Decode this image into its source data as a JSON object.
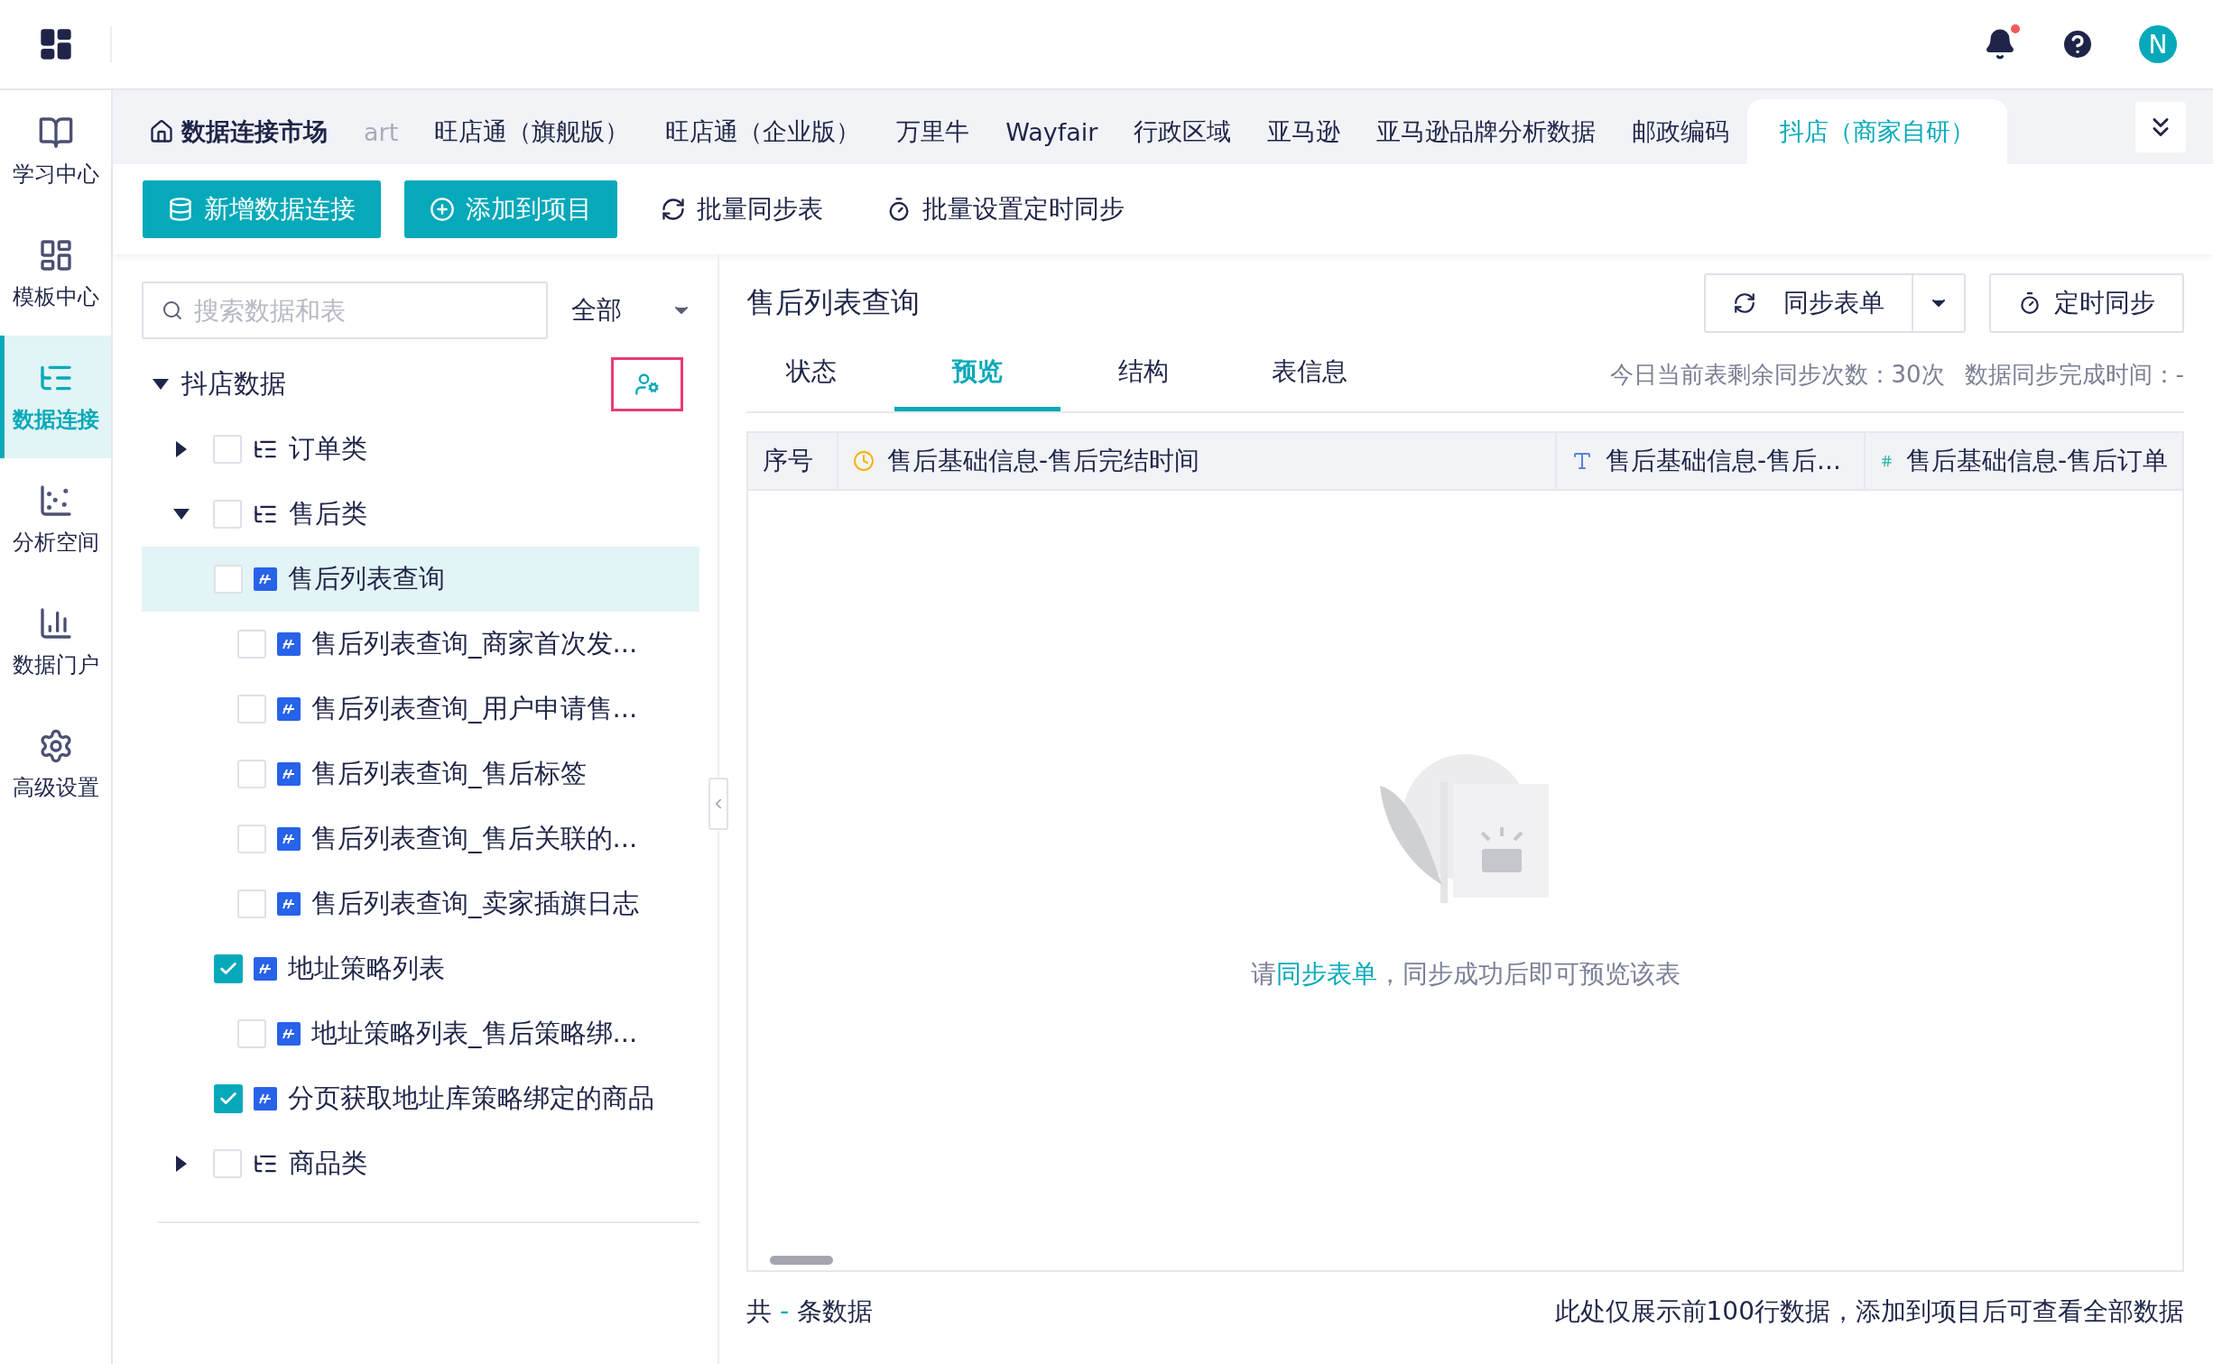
{
  "header": {
    "avatar": "N",
    "has_notification": true
  },
  "sidebar": {
    "items": [
      {
        "label": "学习中心",
        "selected": false
      },
      {
        "label": "模板中心",
        "selected": false
      },
      {
        "label": "数据连接",
        "selected": true
      },
      {
        "label": "分析空间",
        "selected": false
      },
      {
        "label": "数据门户",
        "selected": false
      },
      {
        "label": "高级设置",
        "selected": false
      }
    ]
  },
  "tabs": [
    {
      "label": "数据连接市场",
      "kind": "home",
      "selected": false,
      "clipped": false
    },
    {
      "label": "art",
      "kind": "plain",
      "selected": false,
      "clipped": true
    },
    {
      "label": "旺店通（旗舰版）",
      "kind": "plain",
      "selected": false,
      "clipped": false
    },
    {
      "label": "旺店通（企业版）",
      "kind": "plain",
      "selected": false,
      "clipped": false
    },
    {
      "label": "万里牛",
      "kind": "plain",
      "selected": false,
      "clipped": false
    },
    {
      "label": "Wayfair",
      "kind": "plain",
      "selected": false,
      "clipped": false
    },
    {
      "label": "行政区域",
      "kind": "plain",
      "selected": false,
      "clipped": false
    },
    {
      "label": "亚马逊",
      "kind": "plain",
      "selected": false,
      "clipped": false
    },
    {
      "label": "亚马逊品牌分析数据",
      "kind": "plain",
      "selected": false,
      "clipped": false
    },
    {
      "label": "邮政编码",
      "kind": "plain",
      "selected": false,
      "clipped": false
    },
    {
      "label": "抖店（商家自研）",
      "kind": "plain",
      "selected": true,
      "clipped": false
    }
  ],
  "toolbar": [
    {
      "label": "新增数据连接",
      "kind": "primary"
    },
    {
      "label": "添加到项目",
      "kind": "primary"
    },
    {
      "label": "批量同步表",
      "kind": "text"
    },
    {
      "label": "批量设置定时同步",
      "kind": "text"
    }
  ],
  "search": {
    "placeholder": "搜索数据和表",
    "filter": "全部"
  },
  "tree": {
    "label": "抖店数据",
    "expanded": true,
    "children": [
      {
        "label": "订单类",
        "kind": "folder",
        "checked": false,
        "expanded": false,
        "selected": false
      },
      {
        "label": "售后类",
        "kind": "folder",
        "checked": false,
        "expanded": true,
        "selected": false,
        "children": [
          {
            "label": "售后列表查询",
            "kind": "table",
            "checked": false,
            "selected": true,
            "children": [
              {
                "label": "售后列表查询_商家首次发...",
                "kind": "table",
                "checked": false,
                "selected": false
              },
              {
                "label": "售后列表查询_用户申请售...",
                "kind": "table",
                "checked": false,
                "selected": false
              },
              {
                "label": "售后列表查询_售后标签",
                "kind": "table",
                "checked": false,
                "selected": false
              },
              {
                "label": "售后列表查询_售后关联的...",
                "kind": "table",
                "checked": false,
                "selected": false
              },
              {
                "label": "售后列表查询_卖家插旗日志",
                "kind": "table",
                "checked": false,
                "selected": false
              }
            ]
          },
          {
            "label": "地址策略列表",
            "kind": "table",
            "checked": true,
            "selected": false,
            "children": [
              {
                "label": "地址策略列表_售后策略绑...",
                "kind": "table",
                "checked": false,
                "selected": false
              }
            ]
          },
          {
            "label": "分页获取地址库策略绑定的商品",
            "kind": "table",
            "checked": true,
            "selected": false
          }
        ]
      },
      {
        "label": "商品类",
        "kind": "folder",
        "checked": false,
        "expanded": false,
        "selected": false
      }
    ]
  },
  "detail": {
    "title": "售后列表查询",
    "sync_button": "同步表单",
    "schedule_button": "定时同步",
    "tabs": [
      {
        "label": "状态",
        "selected": false
      },
      {
        "label": "预览",
        "selected": true
      },
      {
        "label": "结构",
        "selected": false
      },
      {
        "label": "表信息",
        "selected": false
      }
    ],
    "sync_count": "今日当前表剩余同步次数：30次",
    "sync_time": "数据同步完成时间：-",
    "columns": [
      {
        "label": "序号",
        "kind": "index"
      },
      {
        "label": "售后基础信息-售后完结时间",
        "kind": "date"
      },
      {
        "label": "售后基础信息-售后...",
        "kind": "text"
      },
      {
        "label": "售后基础信息-售后订单",
        "kind": "number"
      }
    ],
    "empty": {
      "prefix": "请",
      "link": "同步表单",
      "suffix": "，同步成功后即可预览该表"
    },
    "footer": {
      "prefix": "共",
      "count": "-",
      "suffix": "条数据",
      "note": "此处仅展示前100行数据，添加到项目后可查看全部数据"
    }
  }
}
